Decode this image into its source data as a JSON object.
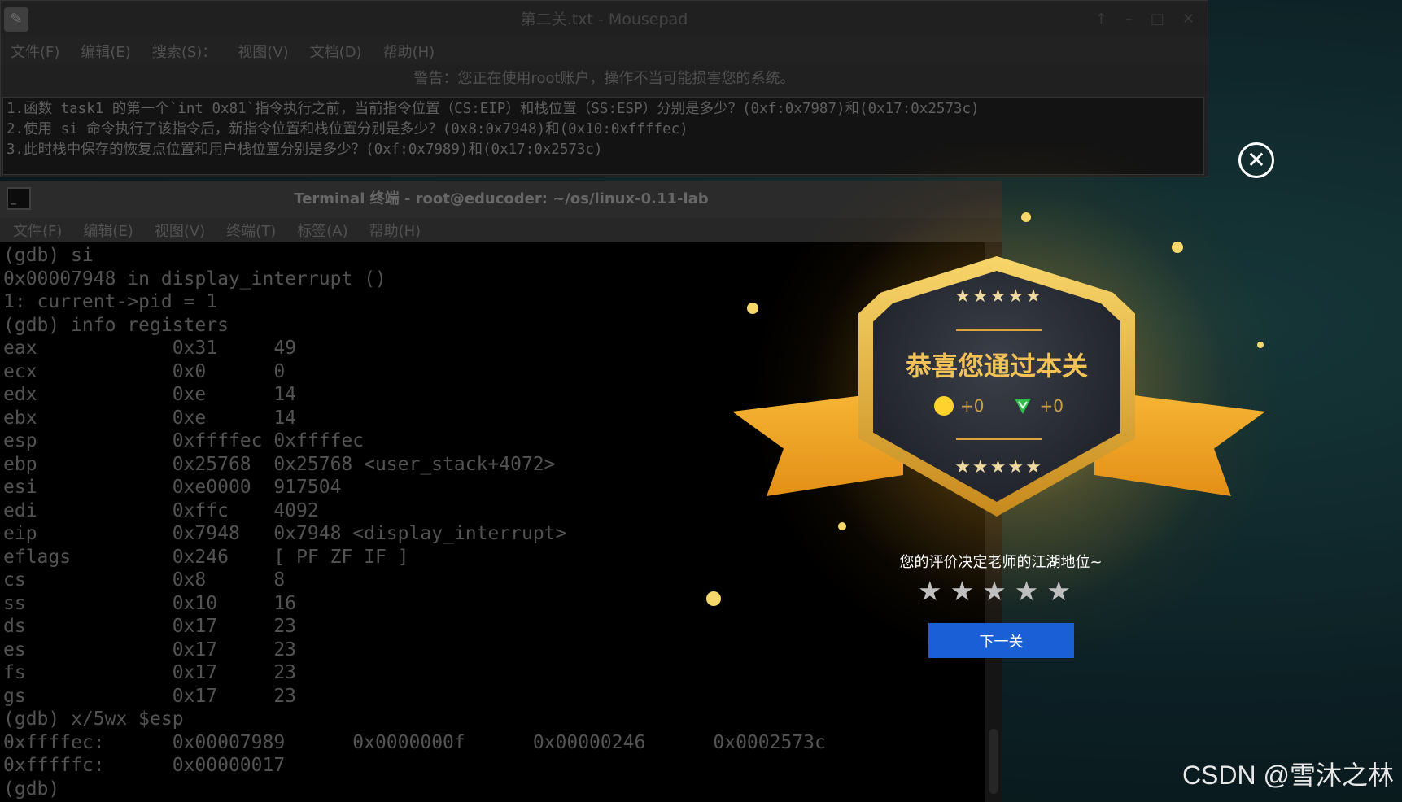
{
  "mousepad": {
    "title": "第二关.txt - Mousepad",
    "controls": [
      "↑",
      "–",
      "□",
      "✕"
    ],
    "menu": [
      "文件(F)",
      "编辑(E)",
      "搜索(S)：",
      "视图(V)",
      "文档(D)",
      "帮助(H)"
    ],
    "warning": "警告：您正在使用root账户，操作不当可能损害您的系统。",
    "lines": [
      "1.函数 task1 的第一个`int 0x81`指令执行之前，当前指令位置（CS:EIP）和栈位置（SS:ESP）分别是多少？(0xf:0x7987)和(0x17:0x2573c)",
      "2.使用 si 命令执行了该指令后，新指令位置和栈位置分别是多少？(0x8:0x7948)和(0x10:0xffffec)",
      "3.此时栈中保存的恢复点位置和用户栈位置分别是多少？(0xf:0x7989)和(0x17:0x2573c)"
    ]
  },
  "terminal": {
    "title": "Terminal 终端 - root@educoder: ~/os/linux-0.11-lab",
    "menu": [
      "文件(F)",
      "编辑(E)",
      "视图(V)",
      "终端(T)",
      "标签(A)",
      "帮助(H)"
    ],
    "lines": [
      "(gdb) si",
      "0x00007948 in display_interrupt ()",
      "1: current->pid = 1",
      "(gdb) info registers",
      "eax            0x31     49",
      "ecx            0x0      0",
      "edx            0xe      14",
      "ebx            0xe      14",
      "esp            0xffffec 0xffffec",
      "ebp            0x25768  0x25768 <user_stack+4072>",
      "esi            0xe0000  917504",
      "edi            0xffc    4092",
      "eip            0x7948   0x7948 <display_interrupt>",
      "eflags         0x246    [ PF ZF IF ]",
      "cs             0x8      8",
      "ss             0x10     16",
      "ds             0x17     23",
      "es             0x17     23",
      "fs             0x17     23",
      "gs             0x17     23",
      "(gdb) x/5wx $esp",
      "0xffffec:      0x00007989      0x0000000f      0x00000246      0x0002573c",
      "0xfffffc:      0x00000017",
      "(gdb)"
    ]
  },
  "reward": {
    "close_icon": "✕",
    "stars_top": "★★★★★",
    "title": "恭喜您通过本关",
    "coin_reward": "+0",
    "shield_reward": "+0",
    "stars_bottom": "★★★★★",
    "evaluation_prompt": "您的评价决定老师的江湖地位~",
    "rating_stars": [
      "★",
      "★",
      "★",
      "★",
      "★"
    ],
    "next_button": "下一关"
  },
  "watermark": "CSDN @雪沐之林",
  "colors": {
    "accent_gold": "#f3c257",
    "next_button": "#1a5fd6",
    "coin": "#ffd22e",
    "shield": "#2fbf4a"
  }
}
